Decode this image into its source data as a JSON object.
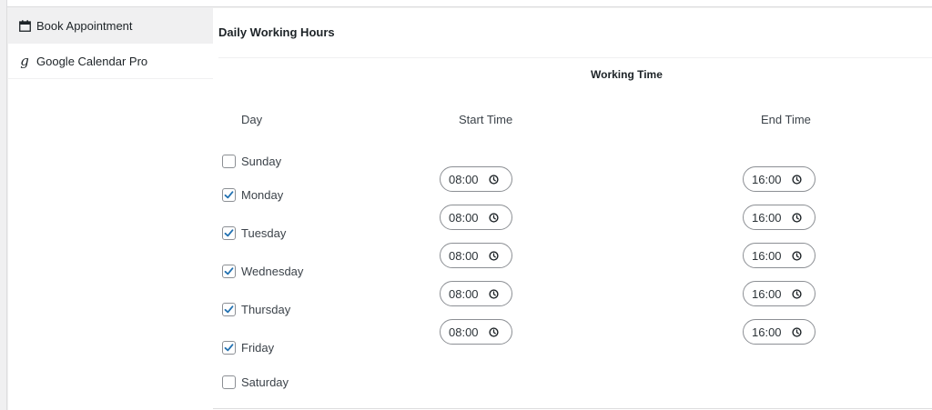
{
  "sidebar": {
    "items": [
      {
        "label": "Book Appointment",
        "icon": "calendar-icon"
      },
      {
        "label": "Google Calendar Pro",
        "icon": "google-g-icon",
        "glyph": "g"
      }
    ]
  },
  "main": {
    "section_title": "Daily Working Hours",
    "working_time_label": "Working Time",
    "columns": {
      "day": "Day",
      "start": "Start Time",
      "end": "End Time"
    },
    "days": [
      {
        "label": "Sunday",
        "checked": false,
        "start": "",
        "end": ""
      },
      {
        "label": "Monday",
        "checked": true,
        "start": "08:00",
        "end": "16:00"
      },
      {
        "label": "Tuesday",
        "checked": true,
        "start": "08:00",
        "end": "16:00"
      },
      {
        "label": "Wednesday",
        "checked": true,
        "start": "08:00",
        "end": "16:00"
      },
      {
        "label": "Thursday",
        "checked": true,
        "start": "08:00",
        "end": "16:00"
      },
      {
        "label": "Friday",
        "checked": true,
        "start": "08:00",
        "end": "16:00"
      },
      {
        "label": "Saturday",
        "checked": false,
        "start": "",
        "end": ""
      }
    ]
  },
  "colors": {
    "accent": "#2271b1",
    "border": "#8c8f94",
    "text": "#3c434a"
  }
}
